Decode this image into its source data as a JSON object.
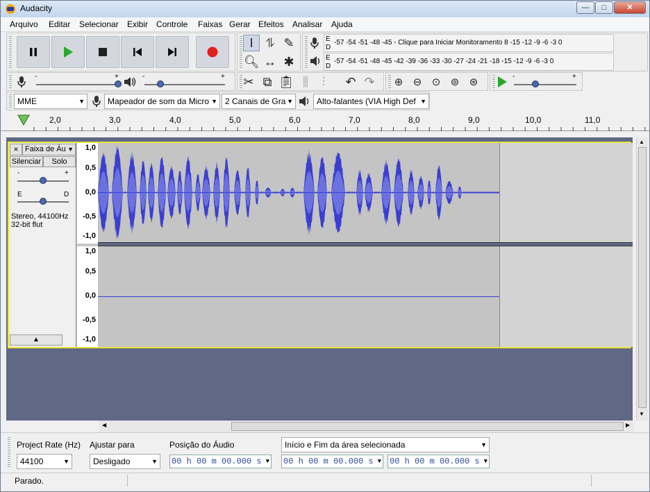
{
  "window": {
    "title": "Audacity"
  },
  "menu": [
    "Arquivo",
    "Editar",
    "Selecionar",
    "Exibir",
    "Controle",
    "Faixas",
    "Gerar",
    "Efeitos",
    "Analisar",
    "Ajuda"
  ],
  "meters": {
    "record_left": "E",
    "record_right": "D",
    "record_scale": "-57 -54 -51 -48 -45 - Clique para Iniciar Monitoramento 8 -15 -12 -9 -6 -3 0",
    "play_left": "E",
    "play_right": "D",
    "play_scale": "-57 -54 -51 -48 -45 -42 -39 -36 -33 -30 -27 -24 -21 -18 -15 -12 -9 -6 -3 0"
  },
  "mixer": {
    "record_volume": 1.0,
    "play_volume": 0.2,
    "plus": "+",
    "minus": "-"
  },
  "devices": {
    "host": "MME",
    "input_device": "Mapeador de som da Micro",
    "channels": "2 Canais de  Gra",
    "output_device": "Alto-falantes (VIA High Def"
  },
  "ruler": {
    "labels": [
      "2,0",
      "3,0",
      "4,0",
      "5,0",
      "6,0",
      "7,0",
      "8,0",
      "9,0",
      "10,0",
      "11,0"
    ]
  },
  "track": {
    "name": "Faixa de Áu",
    "close": "×",
    "mute": "Silenciar",
    "solo": "Solo",
    "gain_minus": "-",
    "gain_plus": "+",
    "pan_left": "E",
    "pan_right": "D",
    "info_line1": "Stereo, 44100Hz",
    "info_line2": "32-bit flut",
    "scale": [
      "1,0",
      "0,5",
      "0,0",
      "-0,5",
      "-1,0"
    ]
  },
  "selection": {
    "rate_label": "Project Rate (Hz)",
    "rate_value": "44100",
    "snap_label": "Ajustar para",
    "snap_value": "Desligado",
    "pos_label": "Posição do Áudio",
    "range_label": "Início e Fim da área selecionada",
    "pos_time": "00 h 00 m 00.000 s",
    "start_time": "00 h 00 m 00.000 s",
    "end_time": "00 h 00 m 00.000 s"
  },
  "status": {
    "text": "Parado."
  },
  "colors": {
    "accent": "#4a68b8",
    "record": "#e12020",
    "play": "#2aa82a",
    "wave": "#3b3fcf",
    "track_border": "#e8e43a"
  }
}
